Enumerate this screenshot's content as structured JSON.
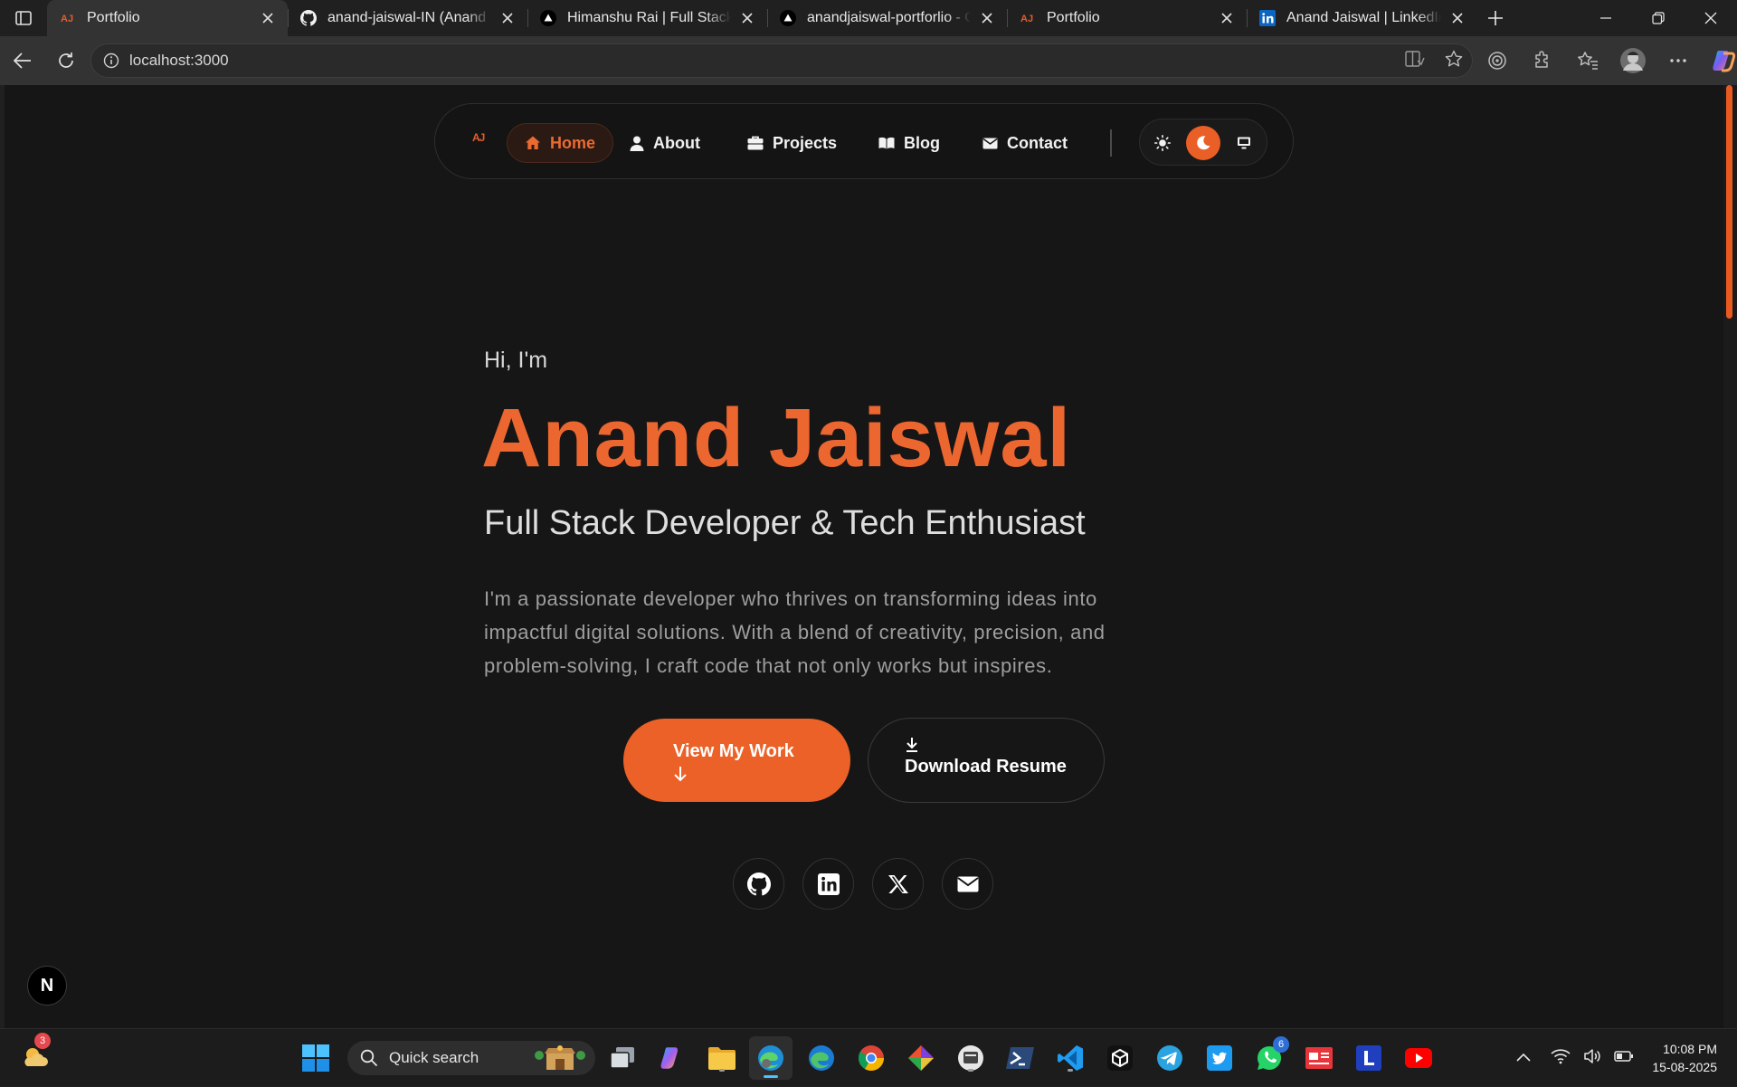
{
  "browser": {
    "tabs": [
      {
        "title": "Portfolio",
        "favicon": "aj-logo-icon",
        "active": true
      },
      {
        "title": "anand-jaiswal-IN (Anand Jaiswal)",
        "favicon": "github-icon",
        "active": false
      },
      {
        "title": "Himanshu Rai | Full Stack • Developer",
        "favicon": "vercel-triangle-icon",
        "active": false
      },
      {
        "title": "anandjaiswal-portforlio - Overview",
        "favicon": "vercel-triangle-icon",
        "active": false
      },
      {
        "title": "Portfolio",
        "favicon": "aj-logo-icon",
        "active": false
      },
      {
        "title": "Anand Jaiswal | LinkedIn",
        "favicon": "linkedin-icon",
        "active": false
      }
    ],
    "url": "localhost:3000"
  },
  "site": {
    "logo": "AJ",
    "nav": [
      {
        "label": "Home",
        "icon": "home-icon",
        "active": true
      },
      {
        "label": "About",
        "icon": "user-icon",
        "active": false
      },
      {
        "label": "Projects",
        "icon": "briefcase-icon",
        "active": false
      },
      {
        "label": "Blog",
        "icon": "book-open-icon",
        "active": false
      },
      {
        "label": "Contact",
        "icon": "envelope-icon",
        "active": false
      }
    ],
    "theme": {
      "options": [
        "light",
        "dark",
        "system"
      ],
      "selected": "dark"
    }
  },
  "hero": {
    "greeting": "Hi, I'm",
    "name": "Anand Jaiswal",
    "role": "Full Stack Developer & Tech Enthusiast",
    "description": "I'm a passionate developer who thrives on transforming ideas into impactful digital solutions. With a blend of creativity, precision, and problem-solving, I craft code that not only works but inspires.",
    "primary_button": "View My Work",
    "secondary_button": "Download Resume",
    "socials": [
      "github-icon",
      "linkedin-icon",
      "x-icon",
      "mail-icon"
    ]
  },
  "dev_badge": "N",
  "colors": {
    "accent": "#eb6127",
    "background": "#161616"
  },
  "taskbar": {
    "weather_badge": "3",
    "search_placeholder": "Quick search",
    "whatsapp_badge": "6",
    "time": "10:08 PM",
    "date": "15-08-2025"
  }
}
